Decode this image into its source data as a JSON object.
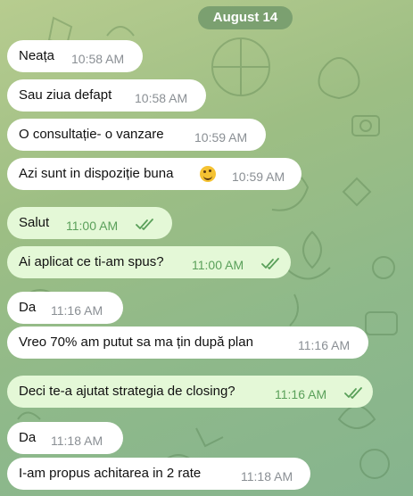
{
  "date_label": "August 14",
  "messages": [
    {
      "text": "Neața",
      "time": "10:58 AM",
      "direction": "in"
    },
    {
      "text": "Sau ziua defapt",
      "time": "10:58 AM",
      "direction": "in"
    },
    {
      "text": "O consultație- o vanzare",
      "time": "10:59 AM",
      "direction": "in"
    },
    {
      "text": "Azi sunt in dispoziție buna",
      "time": "10:59 AM",
      "direction": "in",
      "emoji": "rofl-face-icon"
    },
    {
      "text": "Salut",
      "time": "11:00 AM",
      "direction": "out",
      "status": "read"
    },
    {
      "text": "Ai aplicat ce ti-am spus?",
      "time": "11:00 AM",
      "direction": "out",
      "status": "read"
    },
    {
      "text": "Da",
      "time": "11:16 AM",
      "direction": "in"
    },
    {
      "text": "Vreo 70% am putut sa ma țin după plan",
      "time": "11:16 AM",
      "direction": "in"
    },
    {
      "text": "Deci te-a ajutat strategia de closing?",
      "time": "11:16 AM",
      "direction": "out",
      "status": "read"
    },
    {
      "text": "Da",
      "time": "11:18 AM",
      "direction": "in"
    },
    {
      "text": "I-am propus achitarea in 2 rate",
      "time": "11:18 AM",
      "direction": "in"
    }
  ]
}
